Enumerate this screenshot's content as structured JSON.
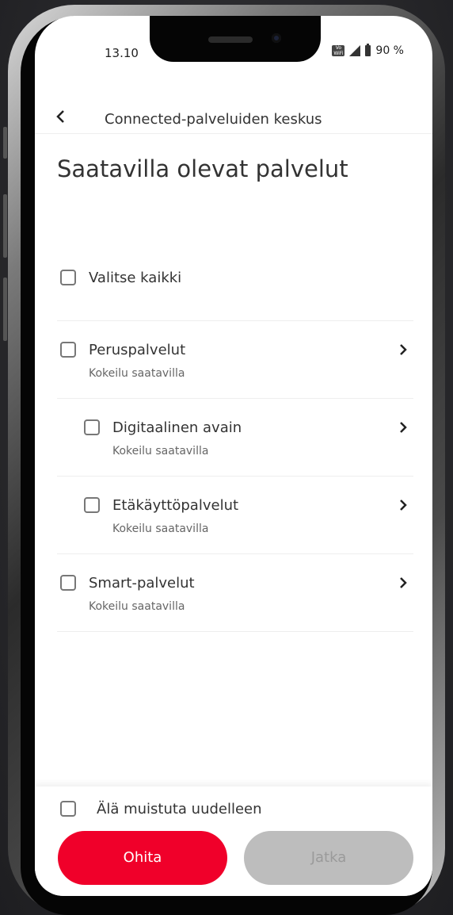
{
  "status_bar": {
    "time": "13.10",
    "battery": "90 %",
    "wifi_badge": "Vo WiFi"
  },
  "header": {
    "back_icon": "chevron-left-icon",
    "title": "Connected-palveluiden keskus"
  },
  "page": {
    "title": "Saatavilla olevat palvelut"
  },
  "services": {
    "select_all": "Valitse kaikki",
    "items": [
      {
        "label": "Peruspalvelut",
        "sub": "Kokeilu saatavilla"
      },
      {
        "label": "Digitaalinen avain",
        "sub": "Kokeilu saatavilla"
      },
      {
        "label": "Etäkäyttöpalvelut",
        "sub": "Kokeilu saatavilla"
      },
      {
        "label": "Smart-palvelut",
        "sub": "Kokeilu saatavilla"
      }
    ]
  },
  "footer": {
    "dont_remind": "Älä muistuta uudelleen",
    "skip_label": "Ohita",
    "continue_label": "Jatka"
  },
  "colors": {
    "primary": "#f0002a",
    "disabled": "#bdbdbd"
  }
}
